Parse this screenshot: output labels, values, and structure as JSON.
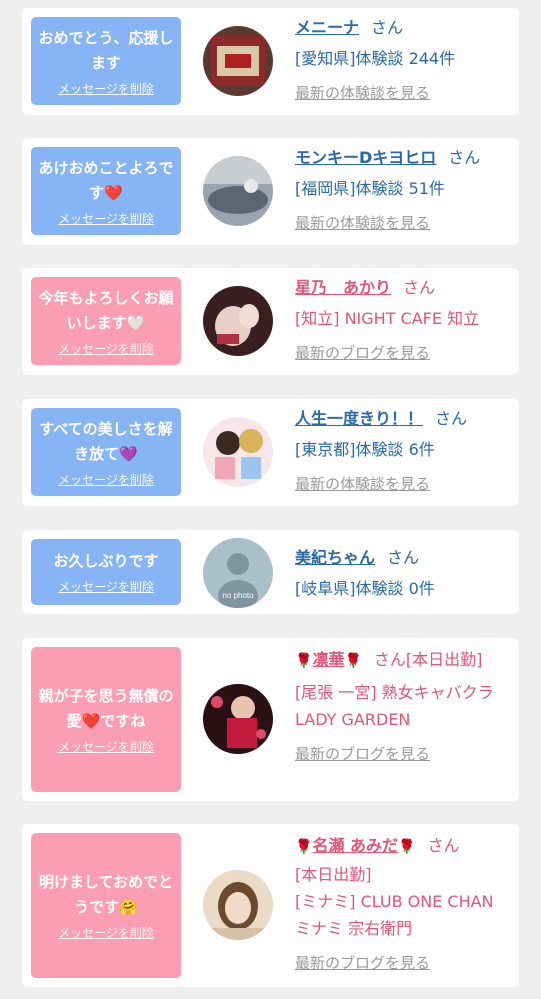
{
  "cards": [
    {
      "message": "おめでとう、応援します",
      "delete_label": "メッセージを削除",
      "name": "メニーナ",
      "san": "さん",
      "detail": "[愛知県]体験談 244件",
      "latest": "最新の体験談を見る",
      "color": "#86b4f4"
    },
    {
      "message": "あけおめことよろです❤️",
      "delete_label": "メッセージを削除",
      "name": "モンキーDキヨヒロ",
      "san": "さん",
      "detail": "[福岡県]体験談 51件",
      "latest": "最新の体験談を見る",
      "color": "#86b4f4"
    },
    {
      "message": "今年もよろしくお願いします🤍",
      "delete_label": "メッセージを削除",
      "name": "星乃　あかり",
      "san": "さん",
      "detail": "[知立] NIGHT CAFE 知立",
      "latest": "最新のブログを見る",
      "color": "#fb9eb3"
    },
    {
      "message": "すべての美しさを解き放て💜",
      "delete_label": "メッセージを削除",
      "name": "人生一度きり！！",
      "san": "さん",
      "detail": "[東京都]体験談 6件",
      "latest": "最新の体験談を見る",
      "color": "#86b4f4"
    },
    {
      "message": "お久しぶりです",
      "delete_label": "メッセージを削除",
      "name": "美紀ちゃん",
      "san": "さん",
      "detail": "[岐阜県]体験談 0件",
      "avatar_text": "no photo",
      "color": "#86b4f4"
    },
    {
      "message": "親が子を思う無償の愛❤️ですね",
      "delete_label": "メッセージを削除",
      "name": "凛華",
      "rose": "🌹",
      "san": "さん[本日出勤]",
      "detail": "[尾張 一宮] 熟女キャバクラ LADY GARDEN",
      "latest": "最新のブログを見る",
      "color": "#fb9eb3"
    },
    {
      "message": "明けましておめでとうです🤗",
      "delete_label": "メッセージを削除",
      "name": "名瀬 あみだ",
      "rose": "🌹",
      "san": "さん",
      "status": "[本日出勤]",
      "detail": "[ミナミ] CLUB ONE CHAN ミナミ 宗右衛門",
      "latest": "最新のブログを見る",
      "color": "#fb9eb3"
    }
  ]
}
